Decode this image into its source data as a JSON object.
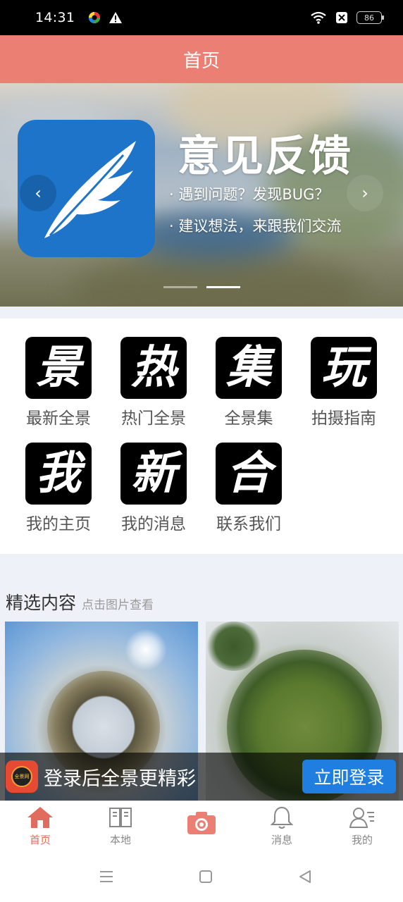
{
  "status_bar": {
    "time": "14:31",
    "battery": "86"
  },
  "header": {
    "title": "首页"
  },
  "banner": {
    "title": "意见反馈",
    "line1": "· 遇到问题？发现BUG？",
    "line2": "· 建议想法，来跟我们交流",
    "prev": "‹",
    "next": "›",
    "active_slide": 2,
    "slide_count": 2
  },
  "menu": {
    "items": [
      {
        "glyph": "景",
        "label": "最新全景"
      },
      {
        "glyph": "热",
        "label": "热门全景"
      },
      {
        "glyph": "集",
        "label": "全景集"
      },
      {
        "glyph": "玩",
        "label": "拍摄指南"
      },
      {
        "glyph": "我",
        "label": "我的主页"
      },
      {
        "glyph": "新",
        "label": "我的消息"
      },
      {
        "glyph": "合",
        "label": "联系我们"
      }
    ]
  },
  "featured": {
    "title": "精选内容",
    "hint": "点击图片查看"
  },
  "login_banner": {
    "text": "登录后全景更精彩",
    "button": "立即登录",
    "logo_text": "全景网"
  },
  "bottom_nav": {
    "items": [
      {
        "label": "首页",
        "icon": "home-icon",
        "active": true
      },
      {
        "label": "本地",
        "icon": "book-icon",
        "active": false
      },
      {
        "label": "",
        "icon": "camera-icon",
        "active": false
      },
      {
        "label": "消息",
        "icon": "bell-icon",
        "active": false
      },
      {
        "label": "我的",
        "icon": "profile-icon",
        "active": false
      }
    ]
  },
  "colors": {
    "accent": "#ec7f74",
    "nav_active": "#e16b5e",
    "login_button": "#1f7ee0",
    "logo_blue": "#1d74c9"
  }
}
